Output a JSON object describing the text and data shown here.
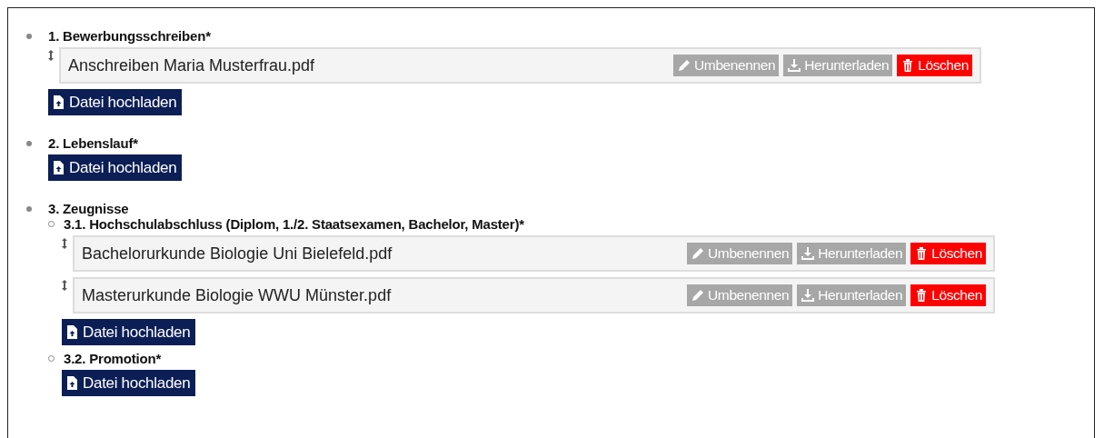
{
  "sections": [
    {
      "title": "1. Bewerbungsschreiben*",
      "files": [
        {
          "name": "Anschreiben Maria Musterfrau.pdf",
          "actions": [
            {
              "kind": "rename",
              "label": "Umbenennen"
            },
            {
              "kind": "download",
              "label": "Herunterladen"
            },
            {
              "kind": "delete",
              "label": "Löschen"
            }
          ]
        }
      ],
      "upload": "Datei hochladen"
    },
    {
      "title": "2. Lebenslauf*",
      "upload": "Datei hochladen"
    },
    {
      "title": "3. Zeugnisse",
      "children": [
        {
          "title": "3.1. Hochschulabschluss (Diplom, 1./2. Staatsexamen, Bachelor, Master)*",
          "files": [
            {
              "name": "Bachelorurkunde Biologie Uni Bielefeld.pdf",
              "actions": [
                {
                  "kind": "rename",
                  "label": "Umbenennen"
                },
                {
                  "kind": "download",
                  "label": "Herunterladen"
                },
                {
                  "kind": "delete",
                  "label": "Löschen"
                }
              ]
            },
            {
              "name": "Masterurkunde Biologie WWU Münster.pdf",
              "actions": [
                {
                  "kind": "rename",
                  "label": "Umbenennen"
                },
                {
                  "kind": "download",
                  "label": "Herunterladen"
                },
                {
                  "kind": "delete",
                  "label": "Löschen"
                }
              ]
            }
          ],
          "upload": "Datei hochladen"
        },
        {
          "title": "3.2. Promotion*",
          "upload": "Datei hochladen"
        }
      ]
    }
  ]
}
